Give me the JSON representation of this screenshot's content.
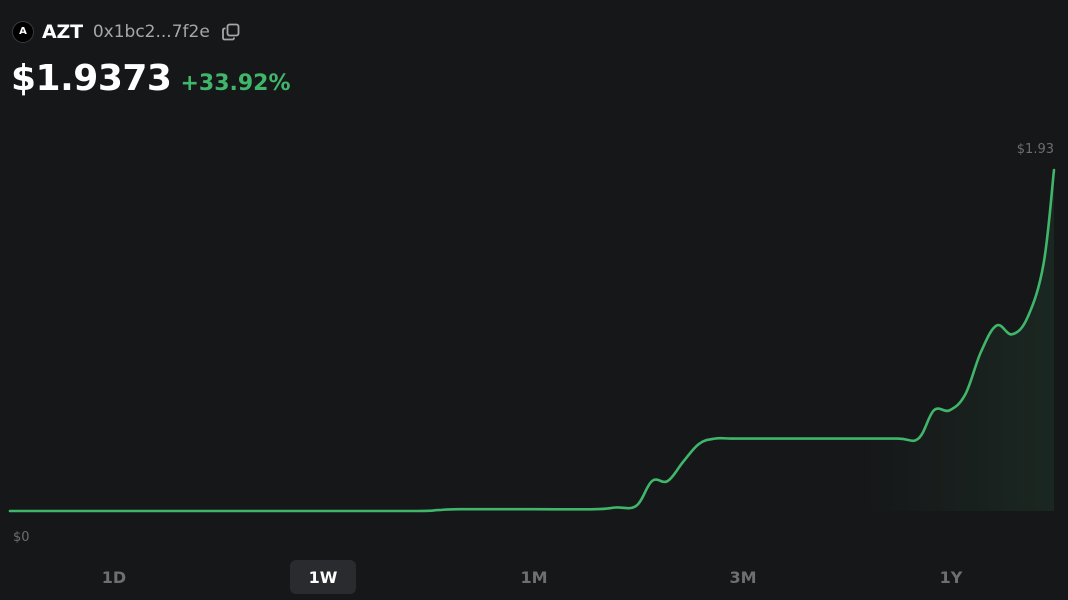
{
  "token": {
    "logo_letter": "A",
    "symbol": "AZT",
    "address": "0x1bc2...7f2e",
    "price": "$1.9373",
    "change": "+33.92%",
    "change_color": "#40b66b",
    "copy_icon": "copy-icon"
  },
  "chart_data": {
    "type": "area",
    "line_color": "#40b66b",
    "ylim": [
      0,
      1.93
    ],
    "y_max_label": "$1.93",
    "y_min_label": "$0",
    "grid": false,
    "x": [
      0,
      0.1,
      0.2,
      0.3,
      0.39,
      0.41,
      0.43,
      0.5,
      0.56,
      0.58,
      0.6,
      0.615,
      0.63,
      0.645,
      0.66,
      0.675,
      0.69,
      0.7,
      0.71,
      0.75,
      0.8,
      0.85,
      0.87,
      0.885,
      0.9,
      0.915,
      0.93,
      0.945,
      0.96,
      0.975,
      0.99,
      1.0
    ],
    "values": [
      0.0,
      0.0,
      0.0,
      0.0,
      0.0,
      0.005,
      0.01,
      0.01,
      0.01,
      0.02,
      0.03,
      0.17,
      0.17,
      0.28,
      0.38,
      0.41,
      0.41,
      0.41,
      0.41,
      0.41,
      0.41,
      0.41,
      0.41,
      0.57,
      0.57,
      0.66,
      0.9,
      1.05,
      1.0,
      1.1,
      1.4,
      1.93
    ]
  },
  "ranges": {
    "items": [
      "1D",
      "1W",
      "1M",
      "3M",
      "1Y"
    ],
    "active": "1W"
  }
}
